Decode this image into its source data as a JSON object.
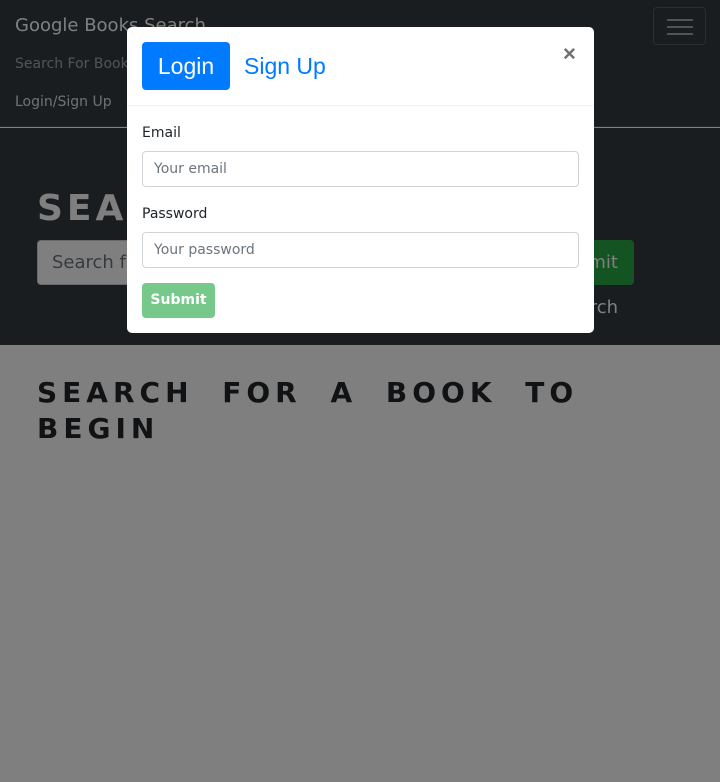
{
  "navbar": {
    "brand": "Google Books Search",
    "search_link": "Search For Books",
    "login_link": "Login/Sign Up"
  },
  "hero": {
    "title": "Search for Books!",
    "search_placeholder": "Search for a book",
    "search_button": "Submit Search"
  },
  "results": {
    "title": "Search for a book to begin"
  },
  "modal": {
    "tabs": {
      "login": "Login",
      "signup": "Sign Up"
    },
    "close_symbol": "×",
    "email_label": "Email",
    "email_placeholder": "Your email",
    "password_label": "Password",
    "password_placeholder": "Your password",
    "submit_label": "Submit"
  },
  "colors": {
    "navbar_bg": "#343a40",
    "primary": "#007bff",
    "success": "#28a745",
    "submit_disabled": "#76c98a"
  }
}
